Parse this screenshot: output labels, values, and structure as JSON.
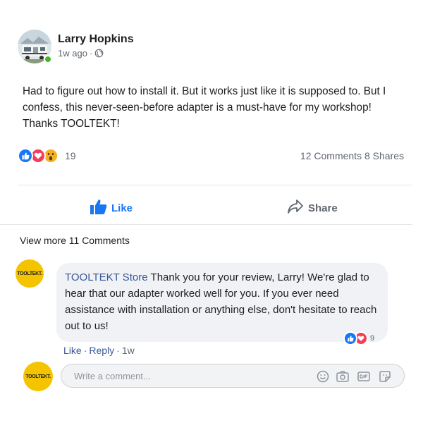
{
  "post": {
    "author": "Larry Hopkins",
    "time": "1w ago",
    "meta_separator": "·",
    "text": "Had to figure out how to install it. But it works just like it is supposed to. But I confess, this never-seen-before adapter is a must-have for my workshop! Thanks TOOLTEKT!",
    "reaction_count": "19",
    "counts_text": "12 Comments 8 Shares",
    "reactions": [
      "like-icon",
      "love-icon",
      "wow-icon"
    ]
  },
  "actions": {
    "like_label": "Like",
    "share_label": "Share"
  },
  "comments_section": {
    "view_more": "View more 11 Comments",
    "avatar_text": "TOOLTEKT.",
    "comment": {
      "author": "TOOLTEKT Store",
      "text": "Thank you for your review, Larry! We're glad to hear that our adapter worked well for you. If you ever need assistance with installation or anything else, don't hesitate to reach out to us!",
      "reaction_count": "9",
      "reactions": [
        "like-icon",
        "love-icon"
      ],
      "like_label": "Like",
      "reply_label": "Reply",
      "time": "1w",
      "separator": "·"
    },
    "write_placeholder": "Write a comment...",
    "tools": [
      "emoji-icon",
      "camera-icon",
      "gif-icon",
      "sticker-icon"
    ]
  },
  "colors": {
    "facebook_blue": "#1877f2",
    "link_blue": "#385898",
    "love_red": "#f33e58",
    "wow_yellow": "#f7b125",
    "brand_yellow": "#f5c400"
  }
}
